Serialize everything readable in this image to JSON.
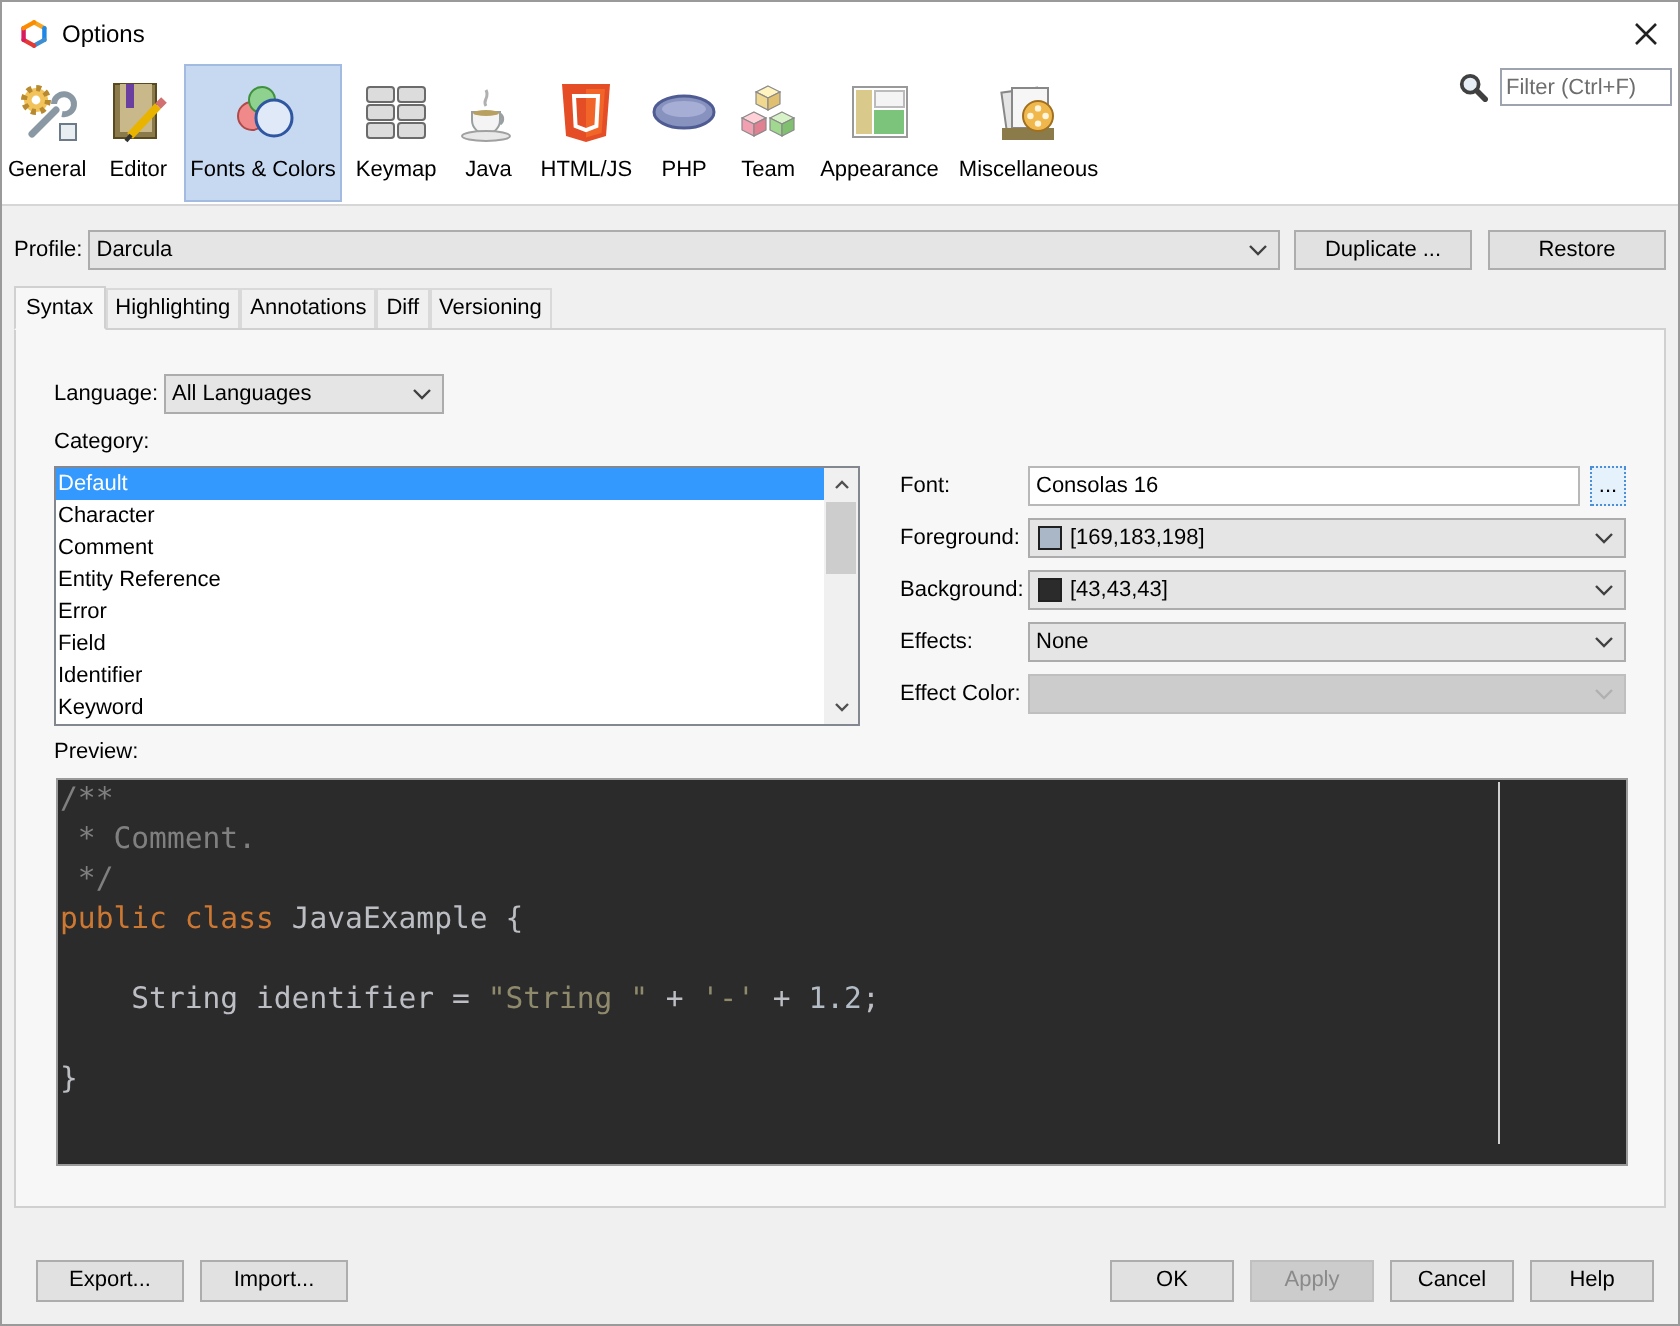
{
  "window": {
    "title": "Options"
  },
  "categories": [
    {
      "label": "General",
      "selected": false
    },
    {
      "label": "Editor",
      "selected": false
    },
    {
      "label": "Fonts & Colors",
      "selected": true
    },
    {
      "label": "Keymap",
      "selected": false
    },
    {
      "label": "Java",
      "selected": false
    },
    {
      "label": "HTML/JS",
      "selected": false
    },
    {
      "label": "PHP",
      "selected": false
    },
    {
      "label": "Team",
      "selected": false
    },
    {
      "label": "Appearance",
      "selected": false
    },
    {
      "label": "Miscellaneous",
      "selected": false
    }
  ],
  "filter": {
    "placeholder": "Filter (Ctrl+F)"
  },
  "profile": {
    "label": "Profile:",
    "value": "Darcula",
    "buttons": [
      "Duplicate ...",
      "Restore"
    ]
  },
  "tabs": [
    {
      "label": "Syntax",
      "selected": true
    },
    {
      "label": "Highlighting",
      "selected": false
    },
    {
      "label": "Annotations",
      "selected": false
    },
    {
      "label": "Diff",
      "selected": false
    },
    {
      "label": "Versioning",
      "selected": false
    }
  ],
  "language": {
    "label": "Language:",
    "value": "All Languages"
  },
  "category": {
    "label": "Category:",
    "items": [
      {
        "label": "Default",
        "selected": true
      },
      {
        "label": "Character",
        "selected": false
      },
      {
        "label": "Comment",
        "selected": false
      },
      {
        "label": "Entity Reference",
        "selected": false
      },
      {
        "label": "Error",
        "selected": false
      },
      {
        "label": "Field",
        "selected": false
      },
      {
        "label": "Identifier",
        "selected": false
      },
      {
        "label": "Keyword",
        "selected": false
      }
    ]
  },
  "properties": [
    {
      "kind": "text",
      "label": "Font:",
      "value": "Consolas 16",
      "button": "...",
      "disabled": false
    },
    {
      "kind": "color",
      "label": "Foreground:",
      "value": "[169,183,198]",
      "color": "#a9b7c6",
      "disabled": false
    },
    {
      "kind": "color",
      "label": "Background:",
      "value": "[43,43,43]",
      "color": "#2b2b2b",
      "disabled": false
    },
    {
      "kind": "select",
      "label": "Effects:",
      "value": "None",
      "disabled": false
    },
    {
      "kind": "select",
      "label": "Effect Color:",
      "disabled": true
    }
  ],
  "preview": {
    "label": "Preview:",
    "code": [
      {
        "kind": "comment",
        "text": "/**\n * Comment.\n */\n"
      },
      {
        "kind": "keyword",
        "text": "public class"
      },
      {
        "kind": "plain",
        "text": " JavaExample {\n\n    String identifier = "
      },
      {
        "kind": "string",
        "text": "\"String \""
      },
      {
        "kind": "plain",
        "text": " + "
      },
      {
        "kind": "char",
        "text": "'-'"
      },
      {
        "kind": "plain",
        "text": " + "
      },
      {
        "kind": "number",
        "text": "1.2"
      },
      {
        "kind": "plain",
        "text": ";\n\n}"
      }
    ]
  },
  "footer": {
    "left": [
      {
        "label": "Export...",
        "disabled": false
      },
      {
        "label": "Import...",
        "disabled": false
      }
    ],
    "right": [
      {
        "label": "OK",
        "disabled": false
      },
      {
        "label": "Apply",
        "disabled": true
      },
      {
        "label": "Cancel",
        "disabled": false
      },
      {
        "label": "Help",
        "disabled": false
      }
    ]
  }
}
